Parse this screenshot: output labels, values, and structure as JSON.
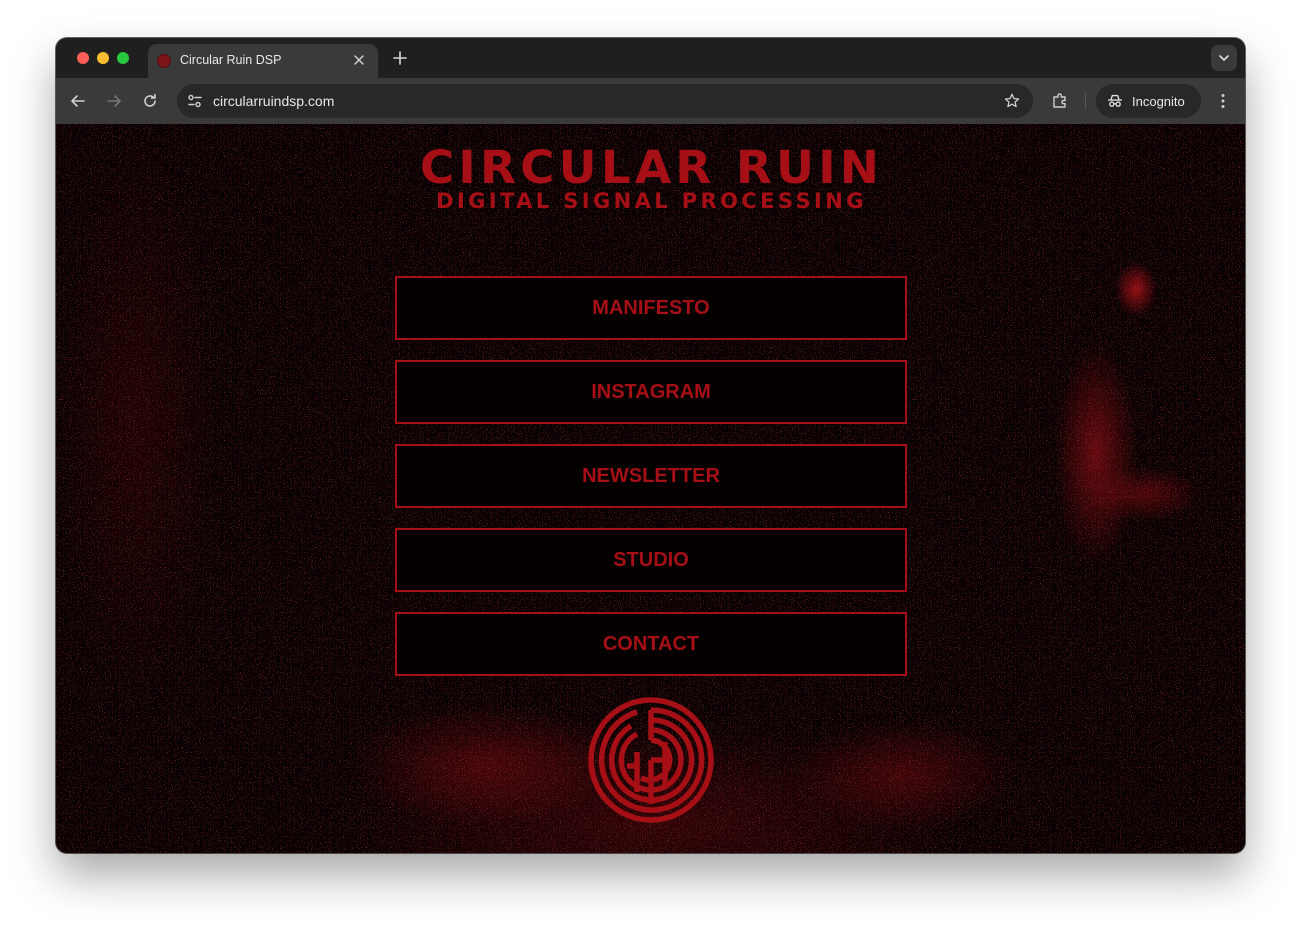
{
  "browser": {
    "tab": {
      "title": "Circular Ruin DSP",
      "favicon": "circular-ruin-favicon",
      "close_icon": "close-icon"
    },
    "new_tab_icon": "plus-icon",
    "tab_menu_icon": "chevron-down-icon",
    "toolbar": {
      "back_icon": "arrow-left-icon",
      "forward_icon": "arrow-right-icon",
      "reload_icon": "reload-icon",
      "site_info_icon": "site-settings-icon",
      "url": "circularruindsp.com",
      "bookmark_icon": "star-icon",
      "extensions_icon": "puzzle-icon",
      "incognito_label": "Incognito",
      "incognito_icon": "incognito-icon",
      "menu_icon": "kebab-menu-icon"
    },
    "traffic_lights": [
      "#ff5f57",
      "#febc2e",
      "#28c840"
    ]
  },
  "page": {
    "brand": {
      "title": "CIRCULAR RUIN",
      "subtitle": "DIGITAL SIGNAL PROCESSING"
    },
    "nav": [
      {
        "label": "MANIFESTO"
      },
      {
        "label": "INSTAGRAM"
      },
      {
        "label": "NEWSLETTER"
      },
      {
        "label": "STUDIO"
      },
      {
        "label": "CONTACT"
      }
    ],
    "logo_icon": "labyrinth-logo-icon",
    "colors": {
      "accent": "#a50f15",
      "background": "#040000"
    }
  }
}
